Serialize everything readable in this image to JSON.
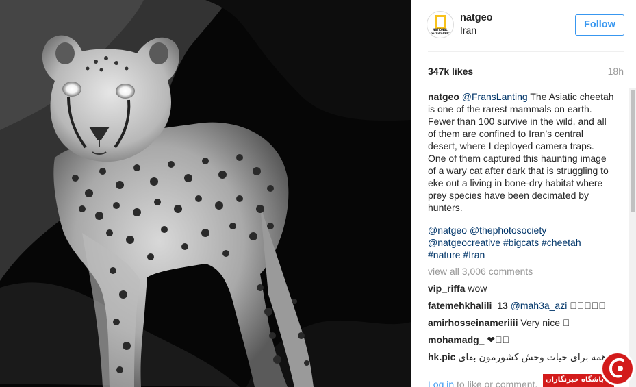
{
  "post": {
    "username": "natgeo",
    "location": "Iran",
    "follow_label": "Follow",
    "likes": "347k likes",
    "time": "18h",
    "avatar_lines": [
      "NATIONAL",
      "GEOGRAPHIC"
    ]
  },
  "caption": {
    "author": "natgeo",
    "mention": "@FransLanting",
    "text": " The Asiatic cheetah is one of the rarest mammals on earth. Fewer than 100 survive in the wild, and all of them are confined to Iran’s central desert, where I deployed camera traps. One of them captured this haunting image of a wary cat after dark that is struggling to eke out a living in bone-dry habitat where prey species have been decimated by hunters."
  },
  "hashtags": [
    "@natgeo",
    "@thephotosociety",
    "@natgeocreative",
    "#bigcats",
    "#cheetah",
    "#nature",
    "#Iran"
  ],
  "view_all": "view all 3,006 comments",
  "comments": [
    {
      "user": "vip_riffa",
      "text": " wow"
    },
    {
      "user": "fatemehkhalili_13",
      "mention": "@mah3a_azi",
      "text": " 􀀀􀀀􀀀􀀀􀀀"
    },
    {
      "user": "amirhosseinameriiii",
      "text": " Very nice 􀀀"
    },
    {
      "user": "mohamadg_",
      "text": " ❤􀀀􀀀"
    },
    {
      "user": "hk.pic",
      "text": " باید همه برای حیات وحش کشورمون بقای"
    }
  ],
  "login": {
    "link": "Log in",
    "rest": " to like or comment."
  },
  "watermark": {
    "text": "باشگاه خبرنگاران"
  },
  "colors": {
    "link_blue": "#3897f0",
    "tag_navy": "#003569",
    "muted_gray": "#999999",
    "watermark_red": "#d31b1b",
    "avatar_yellow": "#f8c21c"
  },
  "icons": {
    "avatar": "national-geographic-logo",
    "watermark": "yjc-news-logo-icon"
  }
}
